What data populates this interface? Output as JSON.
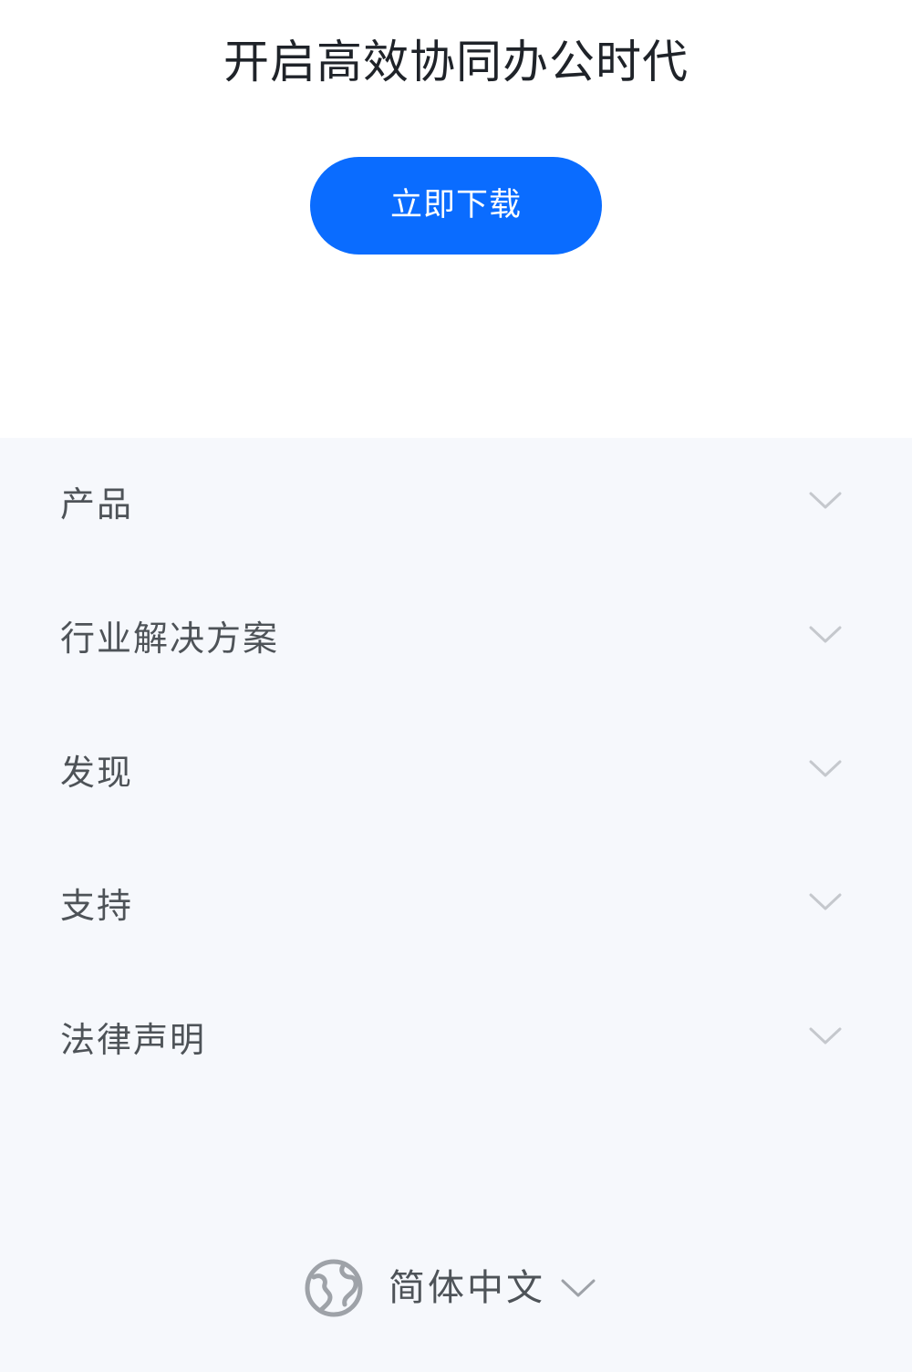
{
  "hero": {
    "title": "开启高效协同办公时代",
    "download_label": "立即下载",
    "accent_color": "#0a6cff"
  },
  "footer_nav": {
    "items": [
      {
        "label": "产品",
        "icon": "chevron-down-icon"
      },
      {
        "label": "行业解决方案",
        "icon": "chevron-down-icon"
      },
      {
        "label": "发现",
        "icon": "chevron-down-icon"
      },
      {
        "label": "支持",
        "icon": "chevron-down-icon"
      },
      {
        "label": "法律声明",
        "icon": "chevron-down-icon"
      }
    ]
  },
  "language": {
    "current": "简体中文",
    "icon": "globe-icon",
    "dropdown_icon": "chevron-down-icon"
  },
  "colors": {
    "page_background": "#f6f8fc",
    "hero_background": "#ffffff",
    "text_primary": "#1f2329",
    "text_secondary": "#4e5358",
    "chevron": "#c5c8cd"
  }
}
